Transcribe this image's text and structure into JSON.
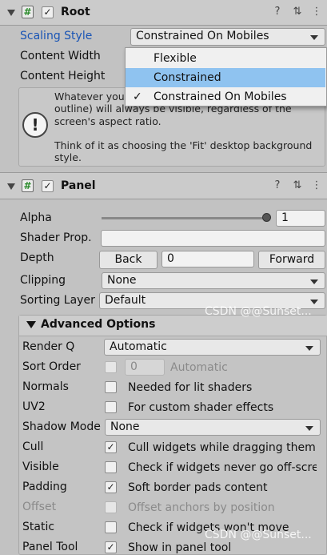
{
  "root_component": {
    "title": "Root",
    "enabled_check": "✓",
    "script_glyph": "#",
    "help_icon": "?",
    "settings_icon": "⇅",
    "menu_icon": "⋮",
    "scaling_style_label": "Scaling Style",
    "scaling_style_value": "Constrained On Mobiles",
    "content_width_label": "Content Width",
    "content_height_label": "Content Height",
    "help_glyph": "!",
    "help_text_1": "Whatever you",
    "help_text_2": "outline) will always be visible, regardless of the",
    "help_text_3": "screen's aspect ratio.",
    "help_text_4": "Think of it as choosing the 'Fit' desktop background",
    "help_text_5": "style.",
    "scaling_options": [
      "Flexible",
      "Constrained",
      "Constrained On Mobiles"
    ],
    "highlighted_option": "Constrained",
    "checked_option": "Constrained On Mobiles",
    "checked_mark": "✓"
  },
  "panel_component": {
    "title": "Panel",
    "enabled_check": "✓",
    "script_glyph": "#",
    "help_icon": "?",
    "settings_icon": "⇅",
    "menu_icon": "⋮",
    "alpha_label": "Alpha",
    "alpha_value": "1",
    "alpha_slider_fraction": 1.0,
    "shader_prop_label": "Shader Prop.",
    "shader_prop_value": "",
    "depth_label": "Depth",
    "back_button": "Back",
    "depth_value": "0",
    "forward_button": "Forward",
    "clipping_label": "Clipping",
    "clipping_value": "None",
    "sorting_layer_label": "Sorting Layer",
    "sorting_layer_value": "Default"
  },
  "advanced": {
    "header": "Advanced Options",
    "render_q_label": "Render Q",
    "render_q_value": "Automatic",
    "sort_order_label": "Sort Order",
    "sort_order_value": "0",
    "sort_order_auto": "Automatic",
    "normals_label": "Normals",
    "normals_desc": "Needed for lit shaders",
    "normals_checked": false,
    "uv2_label": "UV2",
    "uv2_desc": "For custom shader effects",
    "uv2_checked": false,
    "shadow_mode_label": "Shadow Mode",
    "shadow_mode_value": "None",
    "cull_label": "Cull",
    "cull_desc": "Cull widgets while dragging them",
    "cull_checked": true,
    "visible_label": "Visible",
    "visible_desc": "Check if widgets never go off-screen",
    "visible_checked": false,
    "padding_label": "Padding",
    "padding_desc": "Soft border pads content",
    "padding_checked": true,
    "offset_label": "Offset",
    "offset_desc": "Offset anchors by position",
    "offset_checked": false,
    "static_label": "Static",
    "static_desc": "Check if widgets won't move",
    "static_checked": false,
    "panel_tool_label": "Panel Tool",
    "panel_tool_desc": "Show in panel tool",
    "panel_tool_checked": true,
    "check_mark": "✓"
  },
  "watermark": "CSDN @@Sunset..."
}
